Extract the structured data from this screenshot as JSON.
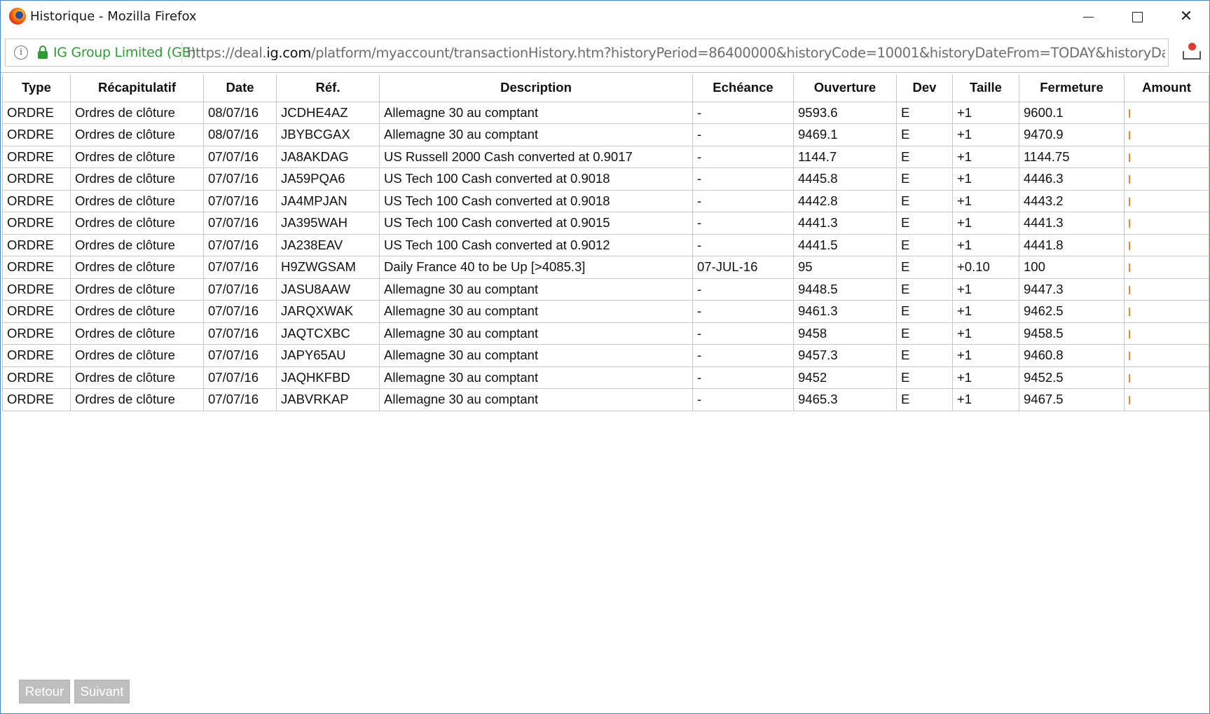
{
  "window": {
    "title": "Historique - Mozilla Firefox",
    "min_label": "",
    "close_label": "✕"
  },
  "urlbar": {
    "identity": "IG Group Limited (GB)",
    "url_prefix": "https://deal.",
    "url_host": "ig.com",
    "url_rest": "/platform/myaccount/transactionHistory.htm?historyPeriod=86400000&historyCode=10001&historyDateFrom=TODAY&historyDateTo"
  },
  "table": {
    "headers": [
      "Type",
      "Récapitulatif",
      "Date",
      "Réf.",
      "Description",
      "Echéance",
      "Ouverture",
      "Dev",
      "Taille",
      "Fermeture",
      "Amount"
    ],
    "rows": [
      [
        "ORDRE",
        "Ordres de clôture",
        "08/07/16",
        "JCDHE4AZ",
        "Allemagne 30 au comptant",
        "-",
        "9593.6",
        "E",
        "+1",
        "9600.1"
      ],
      [
        "ORDRE",
        "Ordres de clôture",
        "08/07/16",
        "JBYBCGAX",
        "Allemagne 30 au comptant",
        "-",
        "9469.1",
        "E",
        "+1",
        "9470.9"
      ],
      [
        "ORDRE",
        "Ordres de clôture",
        "07/07/16",
        "JA8AKDAG",
        "US Russell 2000 Cash converted at 0.9017",
        "-",
        "1144.7",
        "E",
        "+1",
        "1144.75"
      ],
      [
        "ORDRE",
        "Ordres de clôture",
        "07/07/16",
        "JA59PQA6",
        "US Tech 100 Cash converted at 0.9018",
        "-",
        "4445.8",
        "E",
        "+1",
        "4446.3"
      ],
      [
        "ORDRE",
        "Ordres de clôture",
        "07/07/16",
        "JA4MPJAN",
        "US Tech 100 Cash converted at 0.9018",
        "-",
        "4442.8",
        "E",
        "+1",
        "4443.2"
      ],
      [
        "ORDRE",
        "Ordres de clôture",
        "07/07/16",
        "JA395WAH",
        "US Tech 100 Cash converted at 0.9015",
        "-",
        "4441.3",
        "E",
        "+1",
        "4441.3"
      ],
      [
        "ORDRE",
        "Ordres de clôture",
        "07/07/16",
        "JA238EAV",
        "US Tech 100 Cash converted at 0.9012",
        "-",
        "4441.5",
        "E",
        "+1",
        "4441.8"
      ],
      [
        "ORDRE",
        "Ordres de clôture",
        "07/07/16",
        "H9ZWGSAM",
        "Daily France 40 to be Up [>4085.3]",
        "07-JUL-16",
        "95",
        "E",
        "+0.10",
        "100"
      ],
      [
        "ORDRE",
        "Ordres de clôture",
        "07/07/16",
        "JASU8AAW",
        "Allemagne 30 au comptant",
        "-",
        "9448.5",
        "E",
        "+1",
        "9447.3"
      ],
      [
        "ORDRE",
        "Ordres de clôture",
        "07/07/16",
        "JARQXWAK",
        "Allemagne 30 au comptant",
        "-",
        "9461.3",
        "E",
        "+1",
        "9462.5"
      ],
      [
        "ORDRE",
        "Ordres de clôture",
        "07/07/16",
        "JAQTCXBC",
        "Allemagne 30 au comptant",
        "-",
        "9458",
        "E",
        "+1",
        "9458.5"
      ],
      [
        "ORDRE",
        "Ordres de clôture",
        "07/07/16",
        "JAPY65AU",
        "Allemagne 30 au comptant",
        "-",
        "9457.3",
        "E",
        "+1",
        "9460.8"
      ],
      [
        "ORDRE",
        "Ordres de clôture",
        "07/07/16",
        "JAQHKFBD",
        "Allemagne 30 au comptant",
        "-",
        "9452",
        "E",
        "+1",
        "9452.5"
      ],
      [
        "ORDRE",
        "Ordres de clôture",
        "07/07/16",
        "JABVRKAP",
        "Allemagne 30 au comptant",
        "-",
        "9465.3",
        "E",
        "+1",
        "9467.5"
      ]
    ]
  },
  "pagination": {
    "prev_label": "Retour",
    "next_label": "Suivant"
  },
  "colors": {
    "identity_green": "#2e9b34",
    "window_border": "#4a87c8",
    "pager_bg": "#bfbfbf",
    "amount_mark": "#e88a2c"
  }
}
